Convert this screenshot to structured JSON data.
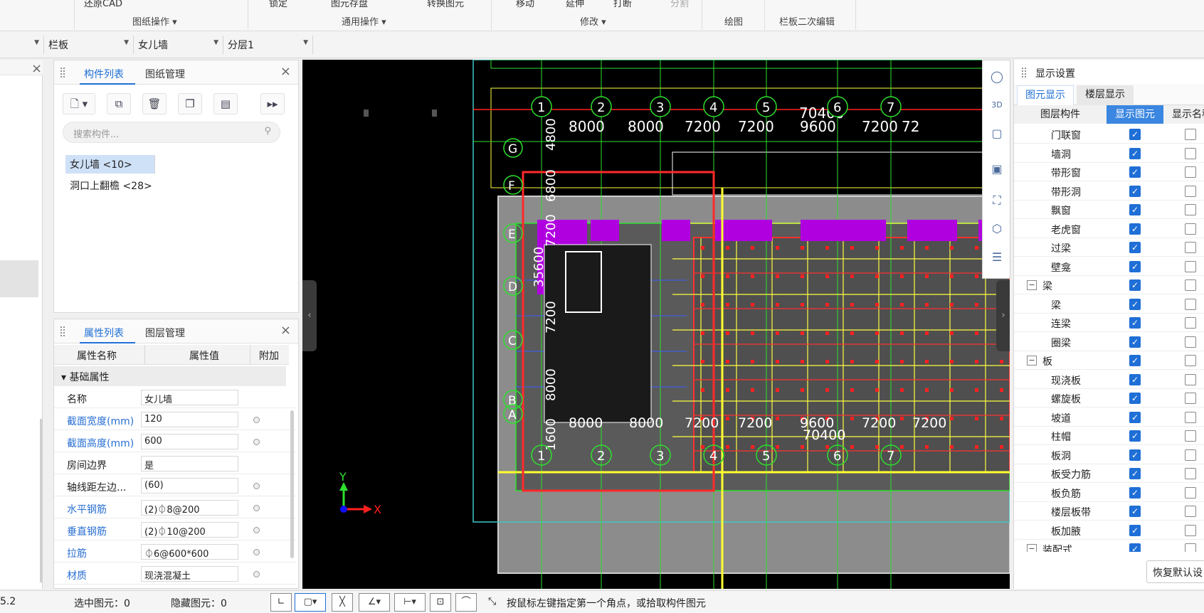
{
  "ribbon": {
    "top_items": [
      "还原CAD",
      "锁定",
      "图元存盘",
      "转换图元",
      "移动",
      "延伸",
      "打断",
      "分割"
    ],
    "groups": [
      "图纸操作",
      "通用操作",
      "修改",
      "绘图",
      "栏板二次编辑"
    ]
  },
  "selectors": [
    "栏板",
    "女儿墙",
    "分层1"
  ],
  "component_panel": {
    "tabs": [
      "构件列表",
      "图纸管理"
    ],
    "search_placeholder": "搜索构件...",
    "items": [
      "女儿墙 <10>",
      "洞口上翻檐 <28>"
    ]
  },
  "property_panel": {
    "tabs": [
      "属性列表",
      "图层管理"
    ],
    "headers": [
      "属性名称",
      "属性值",
      "附加"
    ],
    "group": "基础属性",
    "rows": [
      {
        "name": "名称",
        "value": "女儿墙"
      },
      {
        "name": "截面宽度(mm)",
        "value": "120"
      },
      {
        "name": "截面高度(mm)",
        "value": "600"
      },
      {
        "name": "房间边界",
        "value": "是"
      },
      {
        "name": "轴线距左边...",
        "value": "(60)"
      },
      {
        "name": "水平钢筋",
        "value": "(2)⏀8@200"
      },
      {
        "name": "垂直钢筋",
        "value": "(2)⏀10@200"
      },
      {
        "name": "拉筋",
        "value": "⏀6@600*600"
      },
      {
        "name": "材质",
        "value": "现浇混凝土"
      }
    ]
  },
  "drawing": {
    "top_dims": [
      "8000",
      "8000",
      "7200",
      "7200",
      "9600",
      "7200",
      "72"
    ],
    "bottom_dims": [
      "8000",
      "8000",
      "7200",
      "7200",
      "9600",
      "7200",
      "7200"
    ],
    "total_dim": "70400",
    "axis_numbers": [
      "1",
      "2",
      "3",
      "4",
      "5",
      "6",
      "7"
    ],
    "axis_letters": [
      "G",
      "F",
      "E",
      "D",
      "C",
      "B",
      "A"
    ],
    "left_dims": [
      "4800",
      "6800",
      "7200",
      "35600",
      "7200",
      "8000",
      "1600"
    ],
    "axis_label_x": "X",
    "axis_label_y": "Y"
  },
  "display_panel": {
    "title": "显示设置",
    "tabs": [
      "图元显示",
      "楼层显示"
    ],
    "headers": [
      "图层构件",
      "显示图元",
      "显示名称"
    ],
    "rows": [
      {
        "label": "门联窗",
        "level": 2
      },
      {
        "label": "墙洞",
        "level": 2
      },
      {
        "label": "带形窗",
        "level": 2
      },
      {
        "label": "带形洞",
        "level": 2
      },
      {
        "label": "飘窗",
        "level": 2
      },
      {
        "label": "老虎窗",
        "level": 2
      },
      {
        "label": "过梁",
        "level": 2
      },
      {
        "label": "壁龛",
        "level": 2
      },
      {
        "label": "梁",
        "level": 1
      },
      {
        "label": "梁",
        "level": 2
      },
      {
        "label": "连梁",
        "level": 2
      },
      {
        "label": "圈梁",
        "level": 2
      },
      {
        "label": "板",
        "level": 1
      },
      {
        "label": "现浇板",
        "level": 2
      },
      {
        "label": "螺旋板",
        "level": 2
      },
      {
        "label": "坡道",
        "level": 2
      },
      {
        "label": "柱帽",
        "level": 2
      },
      {
        "label": "板洞",
        "level": 2
      },
      {
        "label": "板受力筋",
        "level": 2
      },
      {
        "label": "板负筋",
        "level": 2
      },
      {
        "label": "楼层板带",
        "level": 2
      },
      {
        "label": "板加腋",
        "level": 2
      },
      {
        "label": "装配式",
        "level": 1
      }
    ],
    "restore_button": "恢复默认设"
  },
  "status": {
    "coord": "5.2",
    "selected": "选中图元：0",
    "hidden": "隐藏图元：0",
    "hint": "按鼠标左键指定第一个角点，或拾取构件图元"
  }
}
